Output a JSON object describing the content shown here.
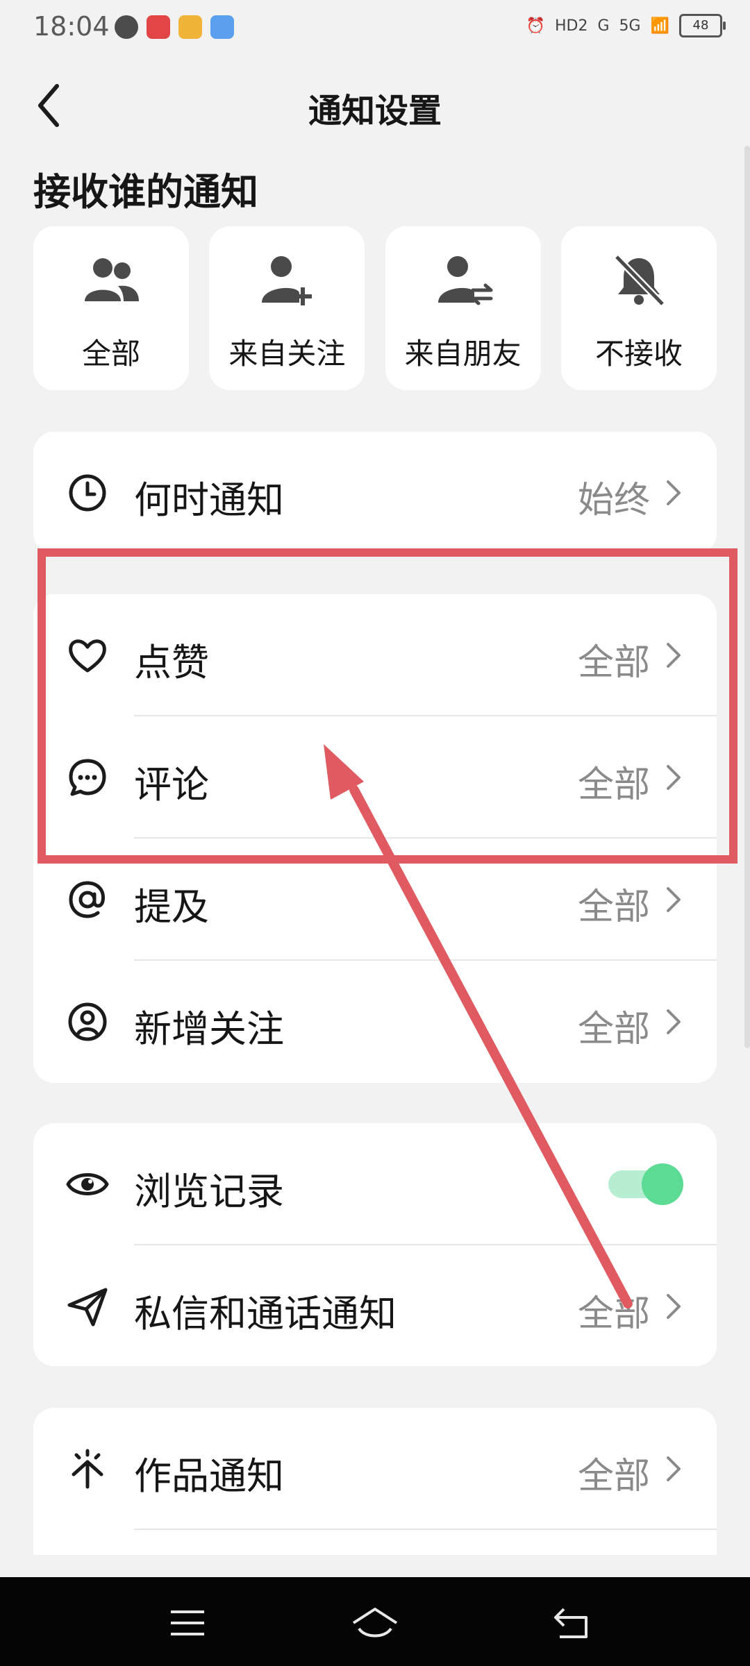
{
  "status_bar": {
    "time": "18:04",
    "battery": "48",
    "network": [
      "HD2",
      "G",
      "5G"
    ]
  },
  "header": {
    "title": "通知设置",
    "back_icon": "chevron-left-icon"
  },
  "receive_section": {
    "title": "接收谁的通知",
    "options": [
      {
        "label": "全部",
        "icon": "people-icon"
      },
      {
        "label": "来自关注",
        "icon": "add-person-icon"
      },
      {
        "label": "来自朋友",
        "icon": "swap-person-icon"
      },
      {
        "label": "不接收",
        "icon": "bell-off-icon"
      }
    ]
  },
  "when_card": {
    "rows": [
      {
        "label": "何时通知",
        "value": "始终",
        "icon": "clock-icon"
      }
    ]
  },
  "interaction_card": {
    "rows": [
      {
        "label": "点赞",
        "value": "全部",
        "icon": "heart-icon"
      },
      {
        "label": "评论",
        "value": "全部",
        "icon": "comment-icon"
      },
      {
        "label": "提及",
        "value": "全部",
        "icon": "at-icon"
      },
      {
        "label": "新增关注",
        "value": "全部",
        "icon": "user-circle-icon"
      }
    ]
  },
  "message_card": {
    "rows": [
      {
        "label": "浏览记录",
        "icon": "eye-icon",
        "toggle_on": true
      },
      {
        "label": "私信和通话通知",
        "value": "全部",
        "icon": "send-icon"
      }
    ]
  },
  "works_card": {
    "rows": [
      {
        "label": "作品通知",
        "value": "全部",
        "icon": "sparkle-icon"
      }
    ]
  },
  "colors": {
    "annotation": "#e05a62",
    "toggle_on": "#5ddb95",
    "value_text": "#8a8a8a"
  }
}
